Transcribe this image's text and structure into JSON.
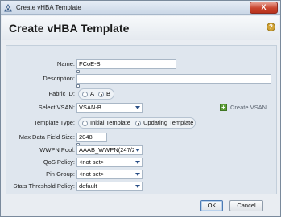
{
  "window": {
    "title": "Create vHBA Template",
    "close_label": "X"
  },
  "header": {
    "title": "Create vHBA Template",
    "help_glyph": "?"
  },
  "form": {
    "name": {
      "label": "Name:",
      "value": "FCoE-B"
    },
    "description": {
      "label": "Description:",
      "value": ""
    },
    "fabric_id": {
      "label": "Fabric ID:",
      "options": [
        "A",
        "B"
      ],
      "selected": "B"
    },
    "select_vsan": {
      "label": "Select VSAN:",
      "value": "VSAN-B"
    },
    "create_vsan": {
      "label": "Create VSAN",
      "icon": "plus-icon"
    },
    "template_type": {
      "label": "Template Type:",
      "options": [
        "Initial Template",
        "Updating Template"
      ],
      "selected": "Updating Template"
    },
    "max_data_field_size": {
      "label": "Max Data Field Size:",
      "value": "2048"
    },
    "wwpn_pool": {
      "label": "WWPN Pool:",
      "value": "AAAB_WWPN(247/2..."
    },
    "qos_policy": {
      "label": "QoS Policy:",
      "value": "<not set>"
    },
    "pin_group": {
      "label": "Pin Group:",
      "value": "<not set>"
    },
    "stats_threshold_policy": {
      "label": "Stats Threshold Policy:",
      "value": "default"
    }
  },
  "footer": {
    "ok_label": "OK",
    "cancel_label": "Cancel"
  },
  "colors": {
    "accent_blue": "#2a4f86",
    "close_red": "#c9452e",
    "plus_green": "#5e9f39",
    "help_gold": "#d2a437"
  }
}
